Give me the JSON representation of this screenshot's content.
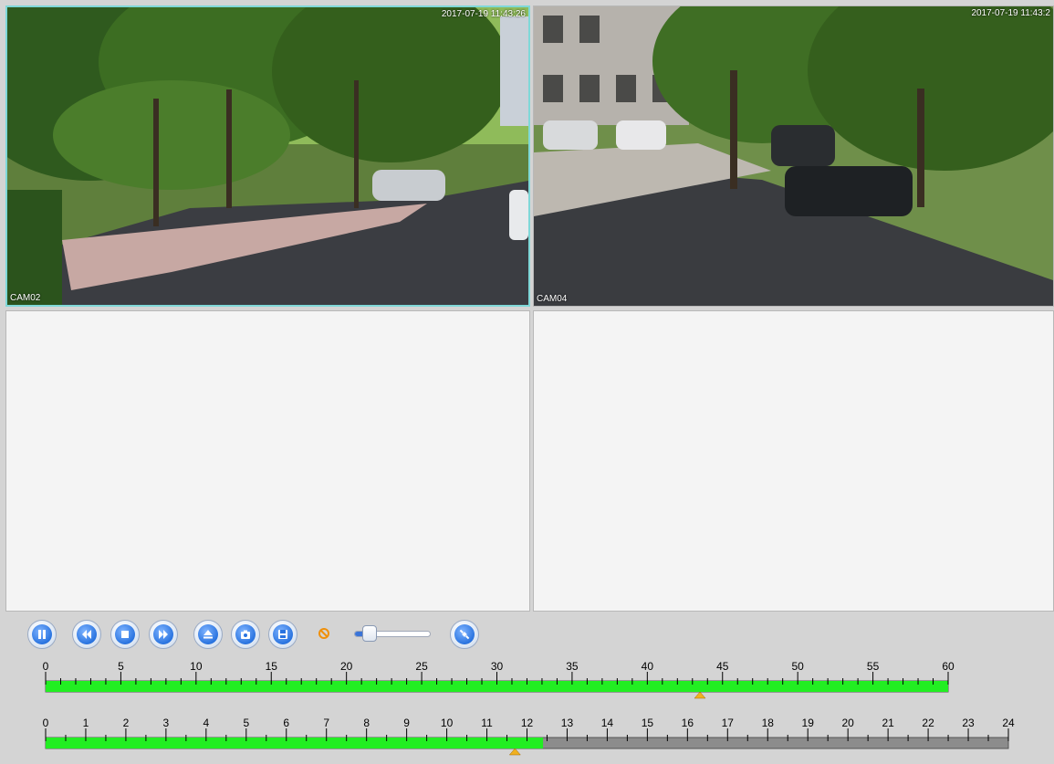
{
  "panes": [
    {
      "label": "CAM02",
      "timestamp": "2017-07-19 11:43:26",
      "selected": true,
      "has_video": true
    },
    {
      "label": "CAM04",
      "timestamp": "2017-07-19 11:43:2",
      "selected": false,
      "has_video": true
    },
    {
      "label": "",
      "timestamp": "",
      "selected": false,
      "has_video": false
    },
    {
      "label": "",
      "timestamp": "",
      "selected": false,
      "has_video": false
    }
  ],
  "controls": {
    "buttons": [
      {
        "name": "pause-button",
        "icon": "pause-icon"
      },
      {
        "name": "rewind-button",
        "icon": "rewind-icon"
      },
      {
        "name": "stop-button",
        "icon": "stop-icon"
      },
      {
        "name": "fast-forward-button",
        "icon": "fast-forward-icon"
      },
      {
        "name": "eject-button",
        "icon": "eject-icon"
      },
      {
        "name": "snapshot-button",
        "icon": "camera-icon"
      },
      {
        "name": "save-button",
        "icon": "floppy-disk-icon"
      },
      {
        "name": "sync-button",
        "icon": "satellite-icon"
      }
    ],
    "volume": {
      "level": 0.2,
      "muted": true
    }
  },
  "minute_timeline": {
    "labels": [
      "0",
      "5",
      "10",
      "15",
      "20",
      "25",
      "30",
      "35",
      "40",
      "45",
      "50",
      "55",
      "60"
    ],
    "range": [
      0,
      60
    ],
    "recorded": [
      [
        0,
        60
      ]
    ],
    "cursor": 43.5
  },
  "hour_timeline": {
    "labels": [
      "0",
      "1",
      "2",
      "3",
      "4",
      "5",
      "6",
      "7",
      "8",
      "9",
      "10",
      "11",
      "12",
      "13",
      "14",
      "15",
      "16",
      "17",
      "18",
      "19",
      "20",
      "21",
      "22",
      "23",
      "24"
    ],
    "range": [
      0,
      24
    ],
    "recorded": [
      [
        0,
        12.4
      ]
    ],
    "cursor": 11.7
  },
  "colors": {
    "recorded": "#22ee22",
    "empty": "#8c8c8c",
    "cursor": "#f0b020",
    "selected_border": "#7fd8d8",
    "button_blue": "#2a74e0"
  }
}
